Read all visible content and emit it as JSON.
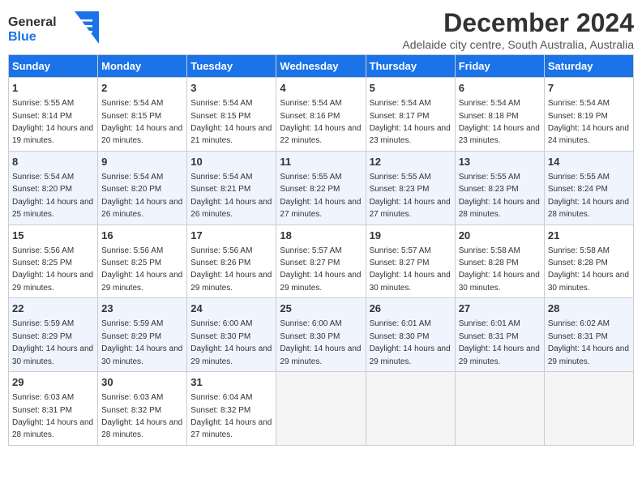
{
  "header": {
    "logo_general": "General",
    "logo_blue": "Blue",
    "title": "December 2024",
    "subtitle": "Adelaide city centre, South Australia, Australia"
  },
  "calendar": {
    "headers": [
      "Sunday",
      "Monday",
      "Tuesday",
      "Wednesday",
      "Thursday",
      "Friday",
      "Saturday"
    ],
    "weeks": [
      [
        {
          "day": "1",
          "sunrise": "Sunrise: 5:55 AM",
          "sunset": "Sunset: 8:14 PM",
          "daylight": "Daylight: 14 hours and 19 minutes."
        },
        {
          "day": "2",
          "sunrise": "Sunrise: 5:54 AM",
          "sunset": "Sunset: 8:15 PM",
          "daylight": "Daylight: 14 hours and 20 minutes."
        },
        {
          "day": "3",
          "sunrise": "Sunrise: 5:54 AM",
          "sunset": "Sunset: 8:15 PM",
          "daylight": "Daylight: 14 hours and 21 minutes."
        },
        {
          "day": "4",
          "sunrise": "Sunrise: 5:54 AM",
          "sunset": "Sunset: 8:16 PM",
          "daylight": "Daylight: 14 hours and 22 minutes."
        },
        {
          "day": "5",
          "sunrise": "Sunrise: 5:54 AM",
          "sunset": "Sunset: 8:17 PM",
          "daylight": "Daylight: 14 hours and 23 minutes."
        },
        {
          "day": "6",
          "sunrise": "Sunrise: 5:54 AM",
          "sunset": "Sunset: 8:18 PM",
          "daylight": "Daylight: 14 hours and 23 minutes."
        },
        {
          "day": "7",
          "sunrise": "Sunrise: 5:54 AM",
          "sunset": "Sunset: 8:19 PM",
          "daylight": "Daylight: 14 hours and 24 minutes."
        }
      ],
      [
        {
          "day": "8",
          "sunrise": "Sunrise: 5:54 AM",
          "sunset": "Sunset: 8:20 PM",
          "daylight": "Daylight: 14 hours and 25 minutes."
        },
        {
          "day": "9",
          "sunrise": "Sunrise: 5:54 AM",
          "sunset": "Sunset: 8:20 PM",
          "daylight": "Daylight: 14 hours and 26 minutes."
        },
        {
          "day": "10",
          "sunrise": "Sunrise: 5:54 AM",
          "sunset": "Sunset: 8:21 PM",
          "daylight": "Daylight: 14 hours and 26 minutes."
        },
        {
          "day": "11",
          "sunrise": "Sunrise: 5:55 AM",
          "sunset": "Sunset: 8:22 PM",
          "daylight": "Daylight: 14 hours and 27 minutes."
        },
        {
          "day": "12",
          "sunrise": "Sunrise: 5:55 AM",
          "sunset": "Sunset: 8:23 PM",
          "daylight": "Daylight: 14 hours and 27 minutes."
        },
        {
          "day": "13",
          "sunrise": "Sunrise: 5:55 AM",
          "sunset": "Sunset: 8:23 PM",
          "daylight": "Daylight: 14 hours and 28 minutes."
        },
        {
          "day": "14",
          "sunrise": "Sunrise: 5:55 AM",
          "sunset": "Sunset: 8:24 PM",
          "daylight": "Daylight: 14 hours and 28 minutes."
        }
      ],
      [
        {
          "day": "15",
          "sunrise": "Sunrise: 5:56 AM",
          "sunset": "Sunset: 8:25 PM",
          "daylight": "Daylight: 14 hours and 29 minutes."
        },
        {
          "day": "16",
          "sunrise": "Sunrise: 5:56 AM",
          "sunset": "Sunset: 8:25 PM",
          "daylight": "Daylight: 14 hours and 29 minutes."
        },
        {
          "day": "17",
          "sunrise": "Sunrise: 5:56 AM",
          "sunset": "Sunset: 8:26 PM",
          "daylight": "Daylight: 14 hours and 29 minutes."
        },
        {
          "day": "18",
          "sunrise": "Sunrise: 5:57 AM",
          "sunset": "Sunset: 8:27 PM",
          "daylight": "Daylight: 14 hours and 29 minutes."
        },
        {
          "day": "19",
          "sunrise": "Sunrise: 5:57 AM",
          "sunset": "Sunset: 8:27 PM",
          "daylight": "Daylight: 14 hours and 30 minutes."
        },
        {
          "day": "20",
          "sunrise": "Sunrise: 5:58 AM",
          "sunset": "Sunset: 8:28 PM",
          "daylight": "Daylight: 14 hours and 30 minutes."
        },
        {
          "day": "21",
          "sunrise": "Sunrise: 5:58 AM",
          "sunset": "Sunset: 8:28 PM",
          "daylight": "Daylight: 14 hours and 30 minutes."
        }
      ],
      [
        {
          "day": "22",
          "sunrise": "Sunrise: 5:59 AM",
          "sunset": "Sunset: 8:29 PM",
          "daylight": "Daylight: 14 hours and 30 minutes."
        },
        {
          "day": "23",
          "sunrise": "Sunrise: 5:59 AM",
          "sunset": "Sunset: 8:29 PM",
          "daylight": "Daylight: 14 hours and 30 minutes."
        },
        {
          "day": "24",
          "sunrise": "Sunrise: 6:00 AM",
          "sunset": "Sunset: 8:30 PM",
          "daylight": "Daylight: 14 hours and 29 minutes."
        },
        {
          "day": "25",
          "sunrise": "Sunrise: 6:00 AM",
          "sunset": "Sunset: 8:30 PM",
          "daylight": "Daylight: 14 hours and 29 minutes."
        },
        {
          "day": "26",
          "sunrise": "Sunrise: 6:01 AM",
          "sunset": "Sunset: 8:30 PM",
          "daylight": "Daylight: 14 hours and 29 minutes."
        },
        {
          "day": "27",
          "sunrise": "Sunrise: 6:01 AM",
          "sunset": "Sunset: 8:31 PM",
          "daylight": "Daylight: 14 hours and 29 minutes."
        },
        {
          "day": "28",
          "sunrise": "Sunrise: 6:02 AM",
          "sunset": "Sunset: 8:31 PM",
          "daylight": "Daylight: 14 hours and 29 minutes."
        }
      ],
      [
        {
          "day": "29",
          "sunrise": "Sunrise: 6:03 AM",
          "sunset": "Sunset: 8:31 PM",
          "daylight": "Daylight: 14 hours and 28 minutes."
        },
        {
          "day": "30",
          "sunrise": "Sunrise: 6:03 AM",
          "sunset": "Sunset: 8:32 PM",
          "daylight": "Daylight: 14 hours and 28 minutes."
        },
        {
          "day": "31",
          "sunrise": "Sunrise: 6:04 AM",
          "sunset": "Sunset: 8:32 PM",
          "daylight": "Daylight: 14 hours and 27 minutes."
        },
        {
          "day": "",
          "sunrise": "",
          "sunset": "",
          "daylight": ""
        },
        {
          "day": "",
          "sunrise": "",
          "sunset": "",
          "daylight": ""
        },
        {
          "day": "",
          "sunrise": "",
          "sunset": "",
          "daylight": ""
        },
        {
          "day": "",
          "sunrise": "",
          "sunset": "",
          "daylight": ""
        }
      ]
    ]
  }
}
